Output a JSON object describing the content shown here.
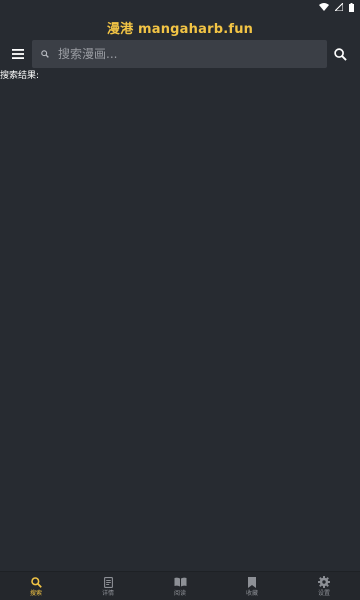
{
  "app": {
    "title": "漫港 mangaharb.fun",
    "accent_color": "#f2c445",
    "background_color": "#272b31"
  },
  "status_bar": {
    "icons": [
      "wifi-icon",
      "signal-icon",
      "battery-icon"
    ]
  },
  "toolbar": {
    "menu_icon": "menu-icon",
    "search_icon": "search-icon"
  },
  "search": {
    "placeholder": "搜索漫画...",
    "value": ""
  },
  "results": {
    "label": "搜索结果:"
  },
  "bottom_nav": {
    "active": "search",
    "items": [
      {
        "key": "search",
        "label": "搜索",
        "icon": "search-icon"
      },
      {
        "key": "details",
        "label": "详情",
        "icon": "document-icon"
      },
      {
        "key": "read",
        "label": "阅读",
        "icon": "book-icon"
      },
      {
        "key": "favorites",
        "label": "收藏",
        "icon": "bookmark-icon"
      },
      {
        "key": "settings",
        "label": "设置",
        "icon": "gear-icon"
      }
    ]
  }
}
